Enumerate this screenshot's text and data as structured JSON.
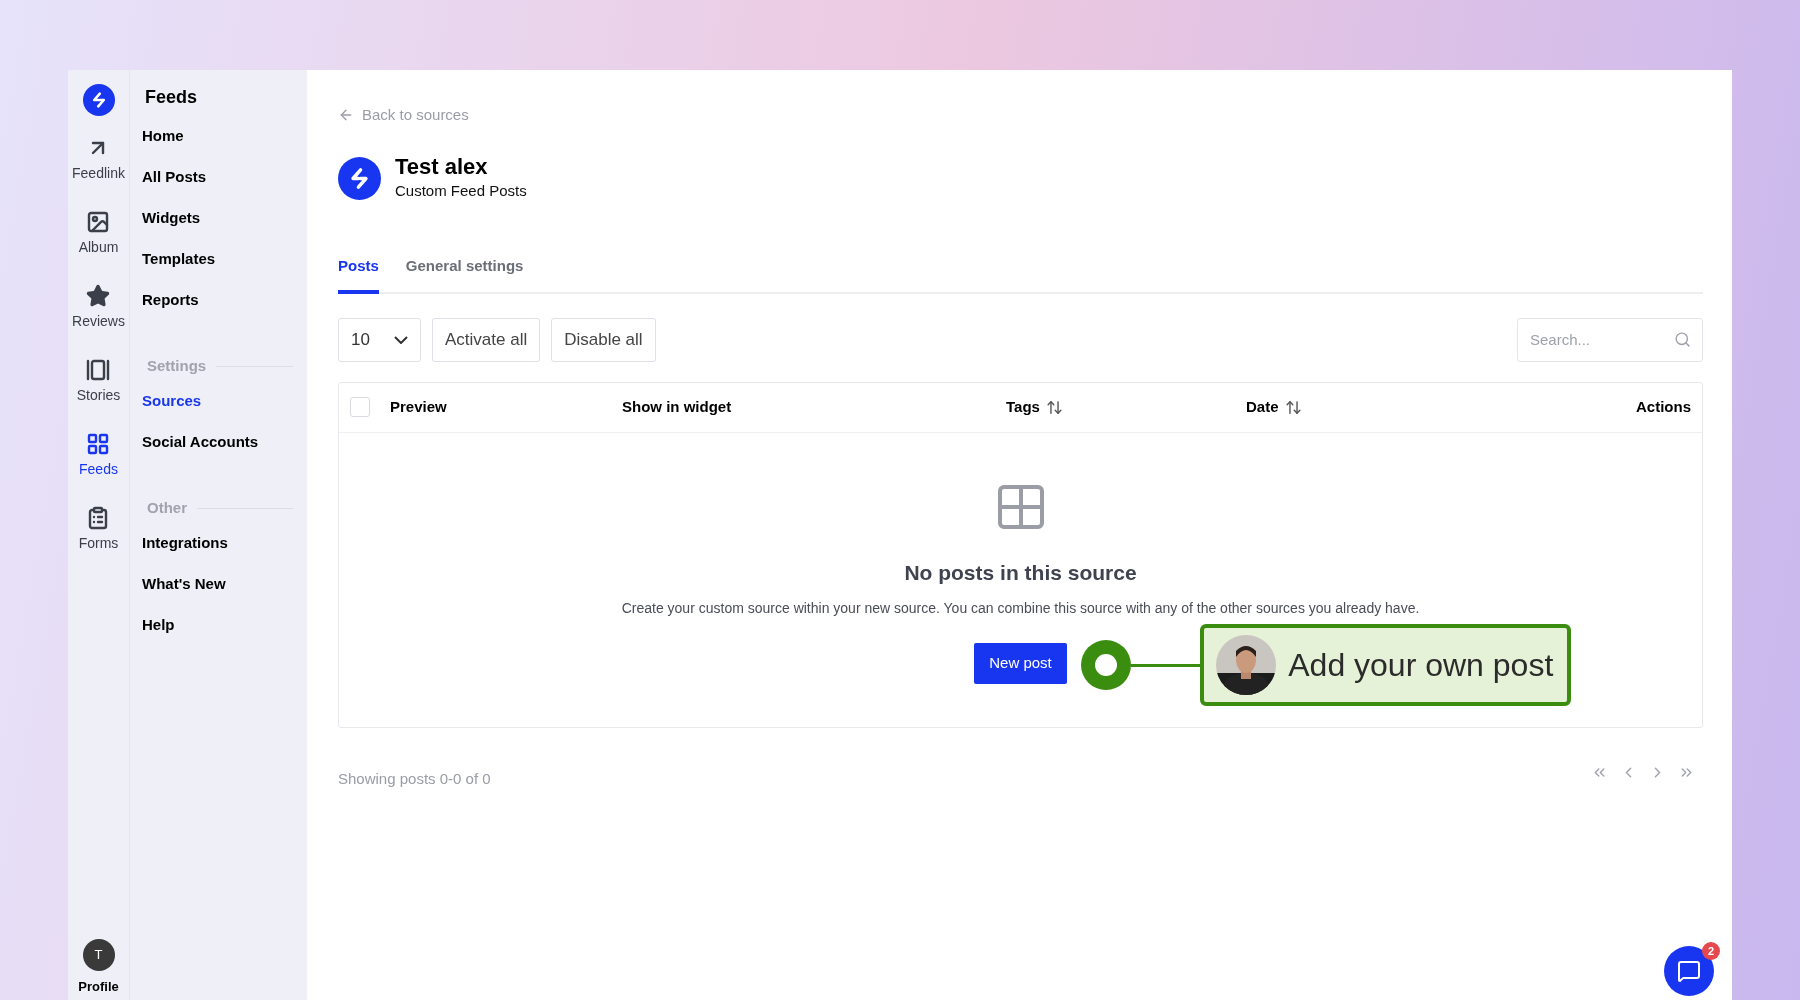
{
  "rail": {
    "items": [
      {
        "label": "Feedlink",
        "selected": false
      },
      {
        "label": "Album",
        "selected": false
      },
      {
        "label": "Reviews",
        "selected": false
      },
      {
        "label": "Stories",
        "selected": false
      },
      {
        "label": "Feeds",
        "selected": true
      },
      {
        "label": "Forms",
        "selected": false
      }
    ],
    "profile": {
      "initial": "T",
      "label": "Profile"
    }
  },
  "sidebar": {
    "title": "Feeds",
    "sections": [
      {
        "items": [
          {
            "label": "Home",
            "selected": false
          },
          {
            "label": "All Posts",
            "selected": false
          },
          {
            "label": "Widgets",
            "selected": false
          },
          {
            "label": "Templates",
            "selected": false
          },
          {
            "label": "Reports",
            "selected": false
          }
        ]
      },
      {
        "heading": "Settings",
        "items": [
          {
            "label": "Sources",
            "selected": true
          },
          {
            "label": "Social Accounts",
            "selected": false
          }
        ]
      },
      {
        "heading": "Other",
        "items": [
          {
            "label": "Integrations",
            "selected": false
          },
          {
            "label": "What's New",
            "selected": false
          },
          {
            "label": "Help",
            "selected": false
          }
        ]
      }
    ]
  },
  "back_link": "Back to sources",
  "source": {
    "title": "Test alex",
    "subtitle": "Custom Feed Posts"
  },
  "tabs": [
    {
      "label": "Posts",
      "selected": true
    },
    {
      "label": "General settings",
      "selected": false
    }
  ],
  "toolbar": {
    "page_size": "10",
    "buttons": [
      "Activate all",
      "Disable all"
    ],
    "search": {
      "placeholder": "Search..."
    }
  },
  "table": {
    "select_all": {
      "checked": false
    },
    "columns": [
      {
        "label": "Preview",
        "sortable": false
      },
      {
        "label": "Show in widget",
        "sortable": false
      },
      {
        "label": "Tags",
        "sortable": true
      },
      {
        "label": "Date",
        "sortable": true
      },
      {
        "label": "Actions",
        "sortable": false
      }
    ],
    "empty": {
      "title": "No posts in this source",
      "text": "Create your custom source within your new source. You can combine this source with any of the other sources you already have.",
      "button": "New post"
    }
  },
  "callout": {
    "text": "Add your own post"
  },
  "footer": {
    "status": "Showing posts 0-0 of 0"
  },
  "chat": {
    "badge": "2"
  }
}
